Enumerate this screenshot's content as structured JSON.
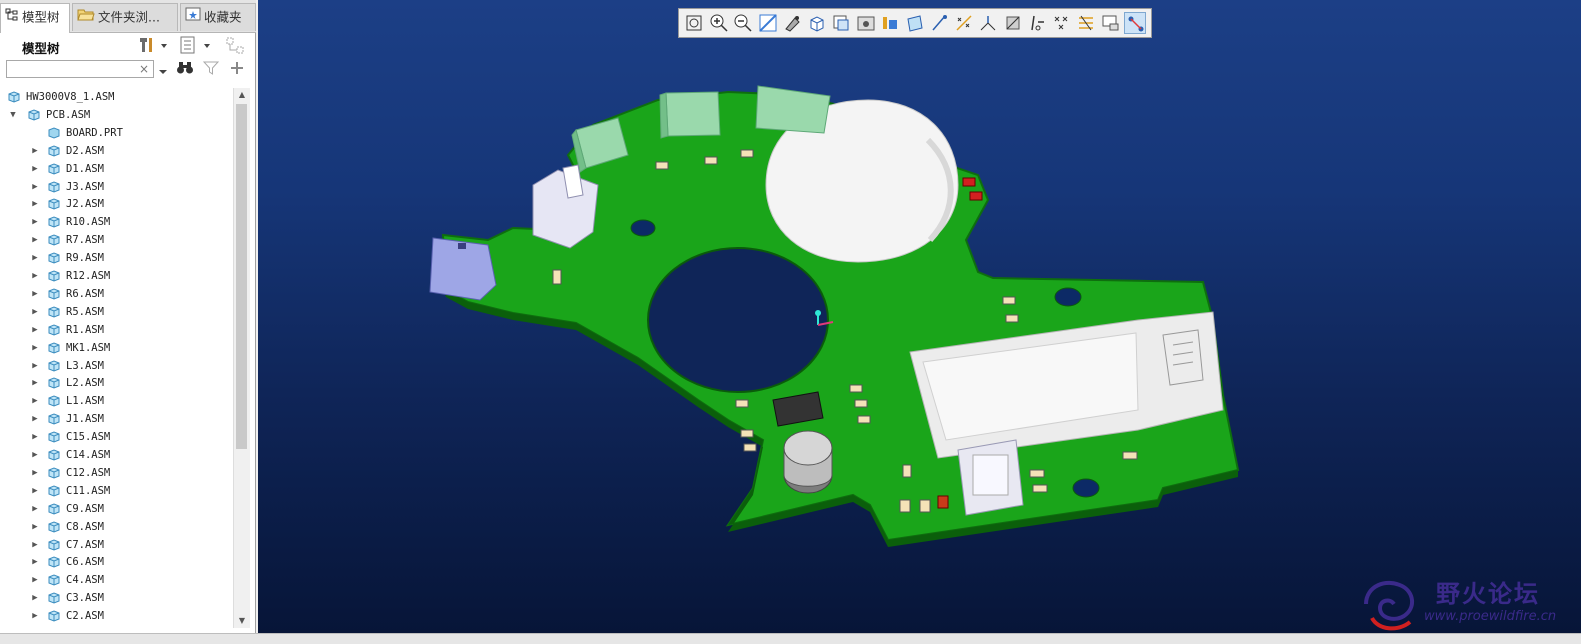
{
  "tabs": [
    {
      "label": "模型树",
      "icon": "model-tree-icon",
      "active": true
    },
    {
      "label": "文件夹浏...",
      "icon": "folder-browser-icon",
      "active": false
    },
    {
      "label": "收藏夹",
      "icon": "favorites-icon",
      "active": false
    }
  ],
  "tree_panel": {
    "title": "模型树",
    "search_placeholder": "",
    "clear_symbol": "×",
    "scroll_up": "▲",
    "scroll_down": "▼"
  },
  "tree": {
    "root": "HW3000V8_1.ASM",
    "pcb": "PCB.ASM",
    "board": "BOARD.PRT",
    "children": [
      "D2.ASM",
      "D1.ASM",
      "J3.ASM",
      "J2.ASM",
      "R10.ASM",
      "R7.ASM",
      "R9.ASM",
      "R12.ASM",
      "R6.ASM",
      "R5.ASM",
      "R1.ASM",
      "MK1.ASM",
      "L3.ASM",
      "L2.ASM",
      "L1.ASM",
      "J1.ASM",
      "C15.ASM",
      "C14.ASM",
      "C12.ASM",
      "C11.ASM",
      "C9.ASM",
      "C8.ASM",
      "C7.ASM",
      "C6.ASM",
      "C4.ASM",
      "C3.ASM",
      "C2.ASM"
    ],
    "expand_arrow": "▶",
    "collapse_arrow": "▼"
  },
  "view_toolbar": {
    "buttons": [
      "zoom-fit-icon",
      "zoom-in-icon",
      "zoom-out-icon",
      "repaint-icon",
      "spin-center-icon",
      "saved-views-icon",
      "display-style-icon",
      "view-manager-icon",
      "perspective-icon",
      "datum-plane-icon",
      "datum-axis-icon",
      "datum-point-icon",
      "csys-icon",
      "annotation-icon",
      "spin-center-display-icon",
      "show-tags-icon",
      "spin-icon",
      "hidden-line-icon",
      "sketch-view-icon",
      "model-display-icon",
      "selected-mode-icon"
    ],
    "selected_index": 20
  },
  "watermark": {
    "text": "野火论坛",
    "url": "www.proewildfire.cn"
  },
  "colors": {
    "pcb": "#1aa51a",
    "viewport_top": "#1c3f86",
    "viewport_bottom": "#071538"
  }
}
